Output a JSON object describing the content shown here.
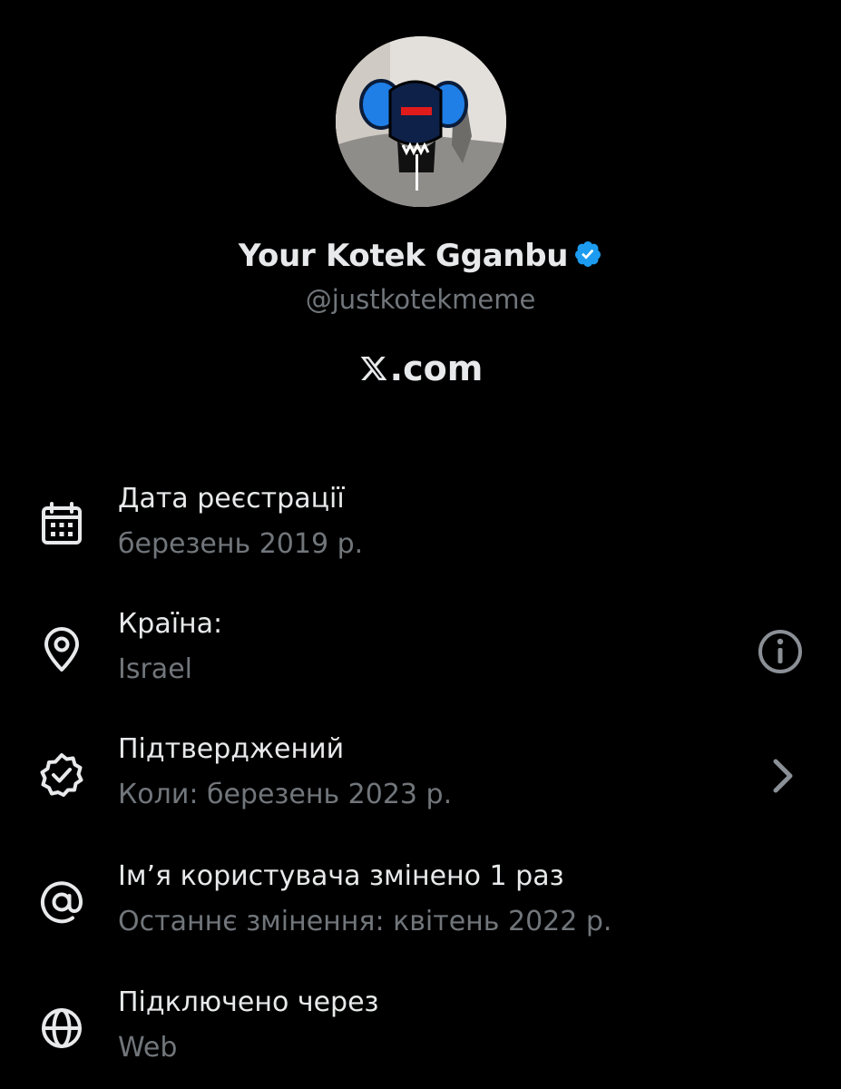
{
  "profile": {
    "display_name": "Your Kotek Gganbu",
    "handle": "@justkotekmeme",
    "site": ".com",
    "verified_badge_icon": "verified-badge-icon",
    "site_logo_icon": "x-logo-icon"
  },
  "colors": {
    "background": "#000000",
    "primary_text": "#e7e9ea",
    "secondary_text": "#71767b",
    "verified_blue": "#1d9bf0"
  },
  "details": [
    {
      "icon": "calendar-icon",
      "title": "Дата реєстрації",
      "subtitle": "березень 2019 р."
    },
    {
      "icon": "location-pin-icon",
      "title": "Країна:",
      "subtitle": "Israel",
      "action_icon": "info-icon"
    },
    {
      "icon": "verified-seal-icon",
      "title": "Підтверджений",
      "subtitle": "Коли: березень 2023 р.",
      "action_icon": "chevron-right-icon"
    },
    {
      "icon": "at-sign-icon",
      "title": "Ім’я користувача змінено 1 раз",
      "subtitle": "Останнє змінення: квітень 2022 р."
    },
    {
      "icon": "globe-icon",
      "title": "Підключено через",
      "subtitle": "Web"
    }
  ]
}
